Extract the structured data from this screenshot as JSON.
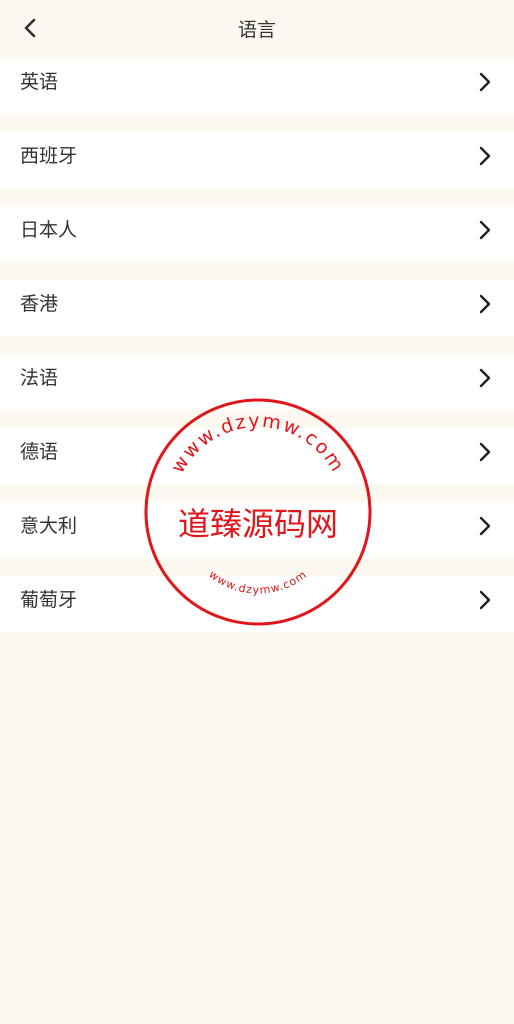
{
  "header": {
    "back_icon": "chevron-left-icon",
    "title": "语言"
  },
  "languages": [
    {
      "label": "英语",
      "icon": "chevron-right-icon"
    },
    {
      "label": "西班牙",
      "icon": "chevron-right-icon"
    },
    {
      "label": "日本人",
      "icon": "chevron-right-icon"
    },
    {
      "label": "香港",
      "icon": "chevron-right-icon"
    },
    {
      "label": "法语",
      "icon": "chevron-right-icon"
    },
    {
      "label": "德语",
      "icon": "chevron-right-icon"
    },
    {
      "label": "意大利",
      "icon": "chevron-right-icon"
    },
    {
      "label": "葡萄牙",
      "icon": "chevron-right-icon"
    }
  ],
  "watermark": {
    "center_text": "道臻源码网",
    "ring_text": "www.dzymw.com",
    "color": "#e0161b"
  },
  "colors": {
    "background": "#fdf8f0",
    "row_background": "#ffffff",
    "text": "#333333"
  }
}
